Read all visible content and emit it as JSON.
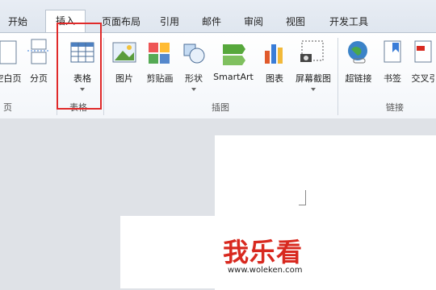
{
  "tabs": [
    "开始",
    "插入",
    "页面布局",
    "引用",
    "邮件",
    "审阅",
    "视图",
    "开发工具"
  ],
  "ribbon": {
    "buttons": [
      "空白页",
      "分页",
      "表格",
      "图片",
      "剪贴画",
      "形状",
      "SmartArt",
      "图表",
      "屏幕截图",
      "超链接",
      "书签",
      "交叉引"
    ],
    "groups": [
      "页",
      "表格",
      "插图",
      "链接"
    ]
  },
  "watermark": {
    "text": "我乐看",
    "url": "www.woleken.com"
  },
  "colors": {
    "highlight": "#e02a2a"
  }
}
